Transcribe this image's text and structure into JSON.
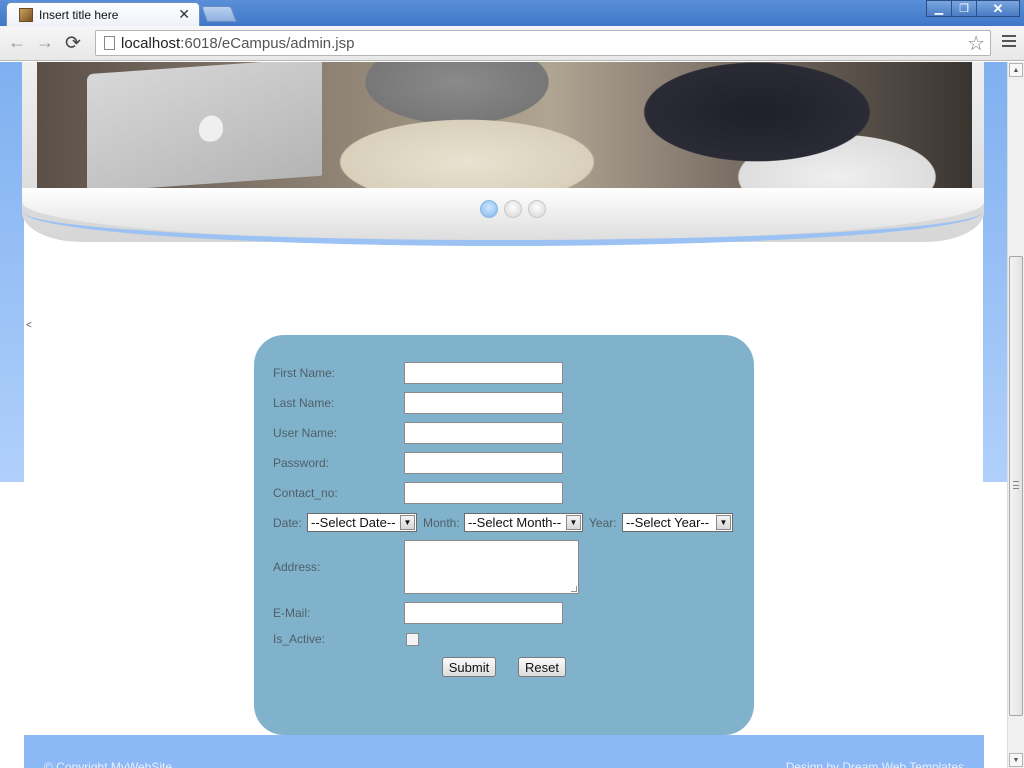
{
  "browser": {
    "tab_title": "Insert title here",
    "tab_close": "✕",
    "url_host": "localhost",
    "url_rest": ":6018/eCampus/admin.jsp",
    "window_buttons": {
      "minimize": "▁",
      "restore": "❐",
      "close": "✕"
    },
    "nav": {
      "back": "←",
      "forward": "→",
      "reload": "⟳",
      "star": "☆"
    }
  },
  "slider": {
    "dot_count": 3,
    "active_dot": 1
  },
  "page": {
    "stray_mark": "<"
  },
  "form": {
    "labels": {
      "first_name": "First Name:",
      "last_name": "Last Name:",
      "user_name": "User Name:",
      "password": "Password:",
      "contact_no": "Contact_no:",
      "date": "Date:",
      "month": "Month:",
      "year": "Year:",
      "address": "Address:",
      "email": "E-Mail:",
      "is_active": "Is_Active:"
    },
    "values": {
      "first_name": "",
      "last_name": "",
      "user_name": "",
      "password": "",
      "contact_no": "",
      "address": "",
      "email": ""
    },
    "selects": {
      "date": "--Select Date--",
      "month": "--Select Month--",
      "year": "--Select Year--"
    },
    "is_active_checked": false,
    "buttons": {
      "submit": "Submit",
      "reset": "Reset"
    }
  },
  "footer": {
    "left": "© Copyright MyWebSite",
    "right": "Design by Dream Web Templates"
  },
  "colors": {
    "form_panel": "#80b2cb",
    "footer": "#8cb8f6",
    "side_gradient_top": "#7fb0f0"
  }
}
